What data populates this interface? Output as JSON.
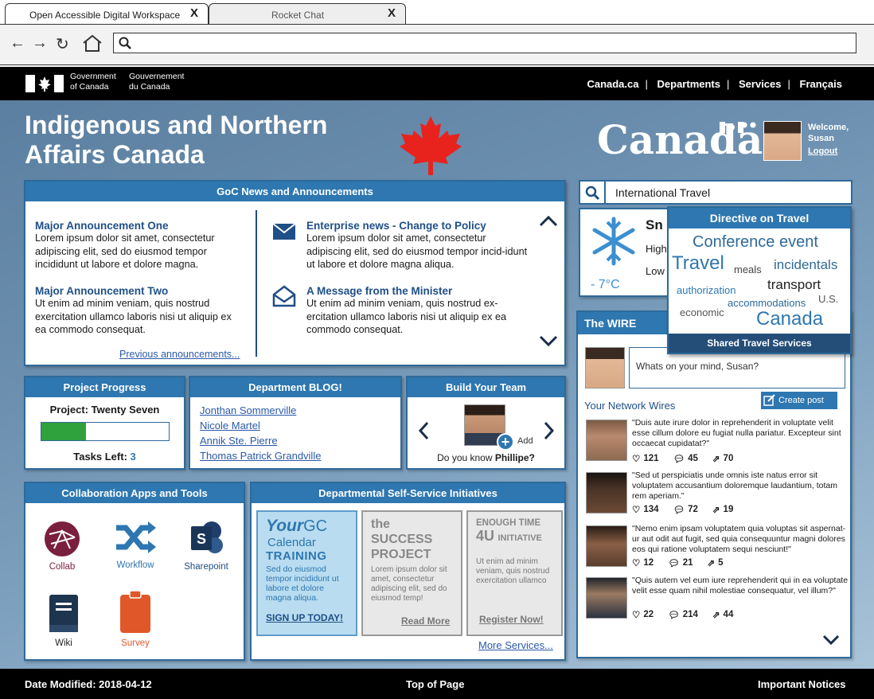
{
  "browser": {
    "tabs": [
      {
        "label": "Open Accessible Digital Workspace",
        "close": "X"
      },
      {
        "label": "Rocket Chat",
        "close": "X"
      }
    ],
    "url": ""
  },
  "gov": {
    "en_line1": "Government",
    "en_line2": "of Canada",
    "fr_line1": "Gouvernement",
    "fr_line2": "du Canada",
    "links": [
      "Canada.ca",
      "Departments",
      "Services",
      "Français"
    ]
  },
  "header": {
    "dept_line1": "Indigenous and Northern",
    "dept_line2": "Affairs Canada",
    "wordmark": "Canadä",
    "welcome": "Welcome,",
    "user": "Susan",
    "logout": "Logout"
  },
  "search": {
    "value": "International Travel"
  },
  "weather": {
    "title": "Sn",
    "high": "High",
    "low": "Low",
    "temp": "- 7°C"
  },
  "travel": {
    "header": "Directive on Travel",
    "footer": "Shared Travel Services",
    "words": [
      "Conference event",
      "Travel",
      "meals",
      "incidentals",
      "authorization",
      "transport",
      "accommodations",
      "U.S.",
      "economic",
      "Canada"
    ]
  },
  "news": {
    "title": "GoC News and Announcements",
    "left": [
      {
        "title": "Major Announcement One",
        "text": "Lorem ipsum dolor sit amet, consectetur adipiscing elit, sed do eiusmod tempor incididunt ut labore et dolore magna."
      },
      {
        "title": "Major Announcement Two",
        "text": "Ut enim ad minim veniam, quis nostrud exercitation ullamco laboris nisi ut aliquip ex ea commodo consequat."
      }
    ],
    "right": [
      {
        "title": "Enterprise news - Change to Policy",
        "text": "Lorem ipsum dolor sit amet, consectetur adipiscing elit, sed do eiusmod tempor incid-idunt ut labore et dolore magna aliqua."
      },
      {
        "title": "A Message from the Minister",
        "text": "Ut enim ad minim veniam, quis nostrud ex-ercitation ullamco laboris nisi ut aliquip ex ea commodo consequat."
      }
    ],
    "previous": "Previous announcements..."
  },
  "progress": {
    "title": "Project Progress",
    "project": "Project: Twenty Seven",
    "tasks_label": "Tasks Left:",
    "tasks_value": "3",
    "fraction": 0.35
  },
  "blog": {
    "title": "Department BLOG!",
    "links": [
      "Jonthan Sommerville",
      "Nicole Martel",
      "Annik Ste. Pierre",
      "Thomas Patrick Grandville"
    ]
  },
  "team": {
    "title": "Build Your Team",
    "add": "Add",
    "know_prefix": "Do you know ",
    "know_name": "Phillipe?"
  },
  "apps": {
    "title": "Collaboration Apps and Tools",
    "items": [
      "Collab",
      "Workflow",
      "Sharepoint",
      "Wiki",
      "Survey"
    ]
  },
  "selfservice": {
    "title": "Departmental Self-Service Initiatives",
    "card1": {
      "your": "Your",
      "gc": "GC",
      "calendar": "Calendar",
      "training": "TRAINING",
      "text": "Sed do eiusmod tempor incididunt ut labore et dolore magna aliqua.",
      "cta": "SIGN UP TODAY!"
    },
    "card2": {
      "the": "the",
      "success": "SUCCESS",
      "project": "PROJECT",
      "text": "Lorem ipsum dolor sit amet, consectetur adipiscing elit, sed do eiusmod temp!",
      "cta": "Read More"
    },
    "card3": {
      "enough": "ENOUGH TIME",
      "u4": "4U",
      "initiative": "INITIATIVE",
      "text": "Ut enim ad minim veniam, quis nostrud exercitation ullamco",
      "cta": "Register Now!"
    },
    "more": "More Services..."
  },
  "wire": {
    "title": "The WIRE",
    "placeholder": "Whats on your mind, Susan?",
    "create": "Create post",
    "network": "Your Network Wires",
    "posts": [
      {
        "text": "\"Duis aute irure dolor in reprehenderit in voluptate velit esse cillum dolore eu fugiat nulla pariatur. Excepteur sint occaecat cupidatat?\"",
        "likes": "121",
        "comments": "45",
        "shares": "70"
      },
      {
        "text": "\"Sed ut perspiciatis unde omnis iste natus error sit voluptatem accusantium doloremque laudantium, totam rem aperiam.\"",
        "likes": "134",
        "comments": "72",
        "shares": "19"
      },
      {
        "text": "\"Nemo enim ipsam voluptatem quia voluptas sit aspernat-ur aut odit aut fugit, sed quia consequuntur magni dolores eos qui ratione voluptatem sequi nesciunt!\"",
        "likes": "12",
        "comments": "21",
        "shares": "5"
      },
      {
        "text": "\"Quis autem vel eum iure reprehenderit qui in ea voluptate velit esse quam nihil molestiae consequatur, vel illum?\"",
        "likes": "22",
        "comments": "214",
        "shares": "44"
      }
    ]
  },
  "footer": {
    "modified": "Date Modified: 2018-04-12",
    "top": "Top of Page",
    "notices": "Important Notices"
  },
  "colors": {
    "accent": "#2e77b0",
    "gov_red": "#e8231e",
    "progress_green": "#2fa13d"
  }
}
